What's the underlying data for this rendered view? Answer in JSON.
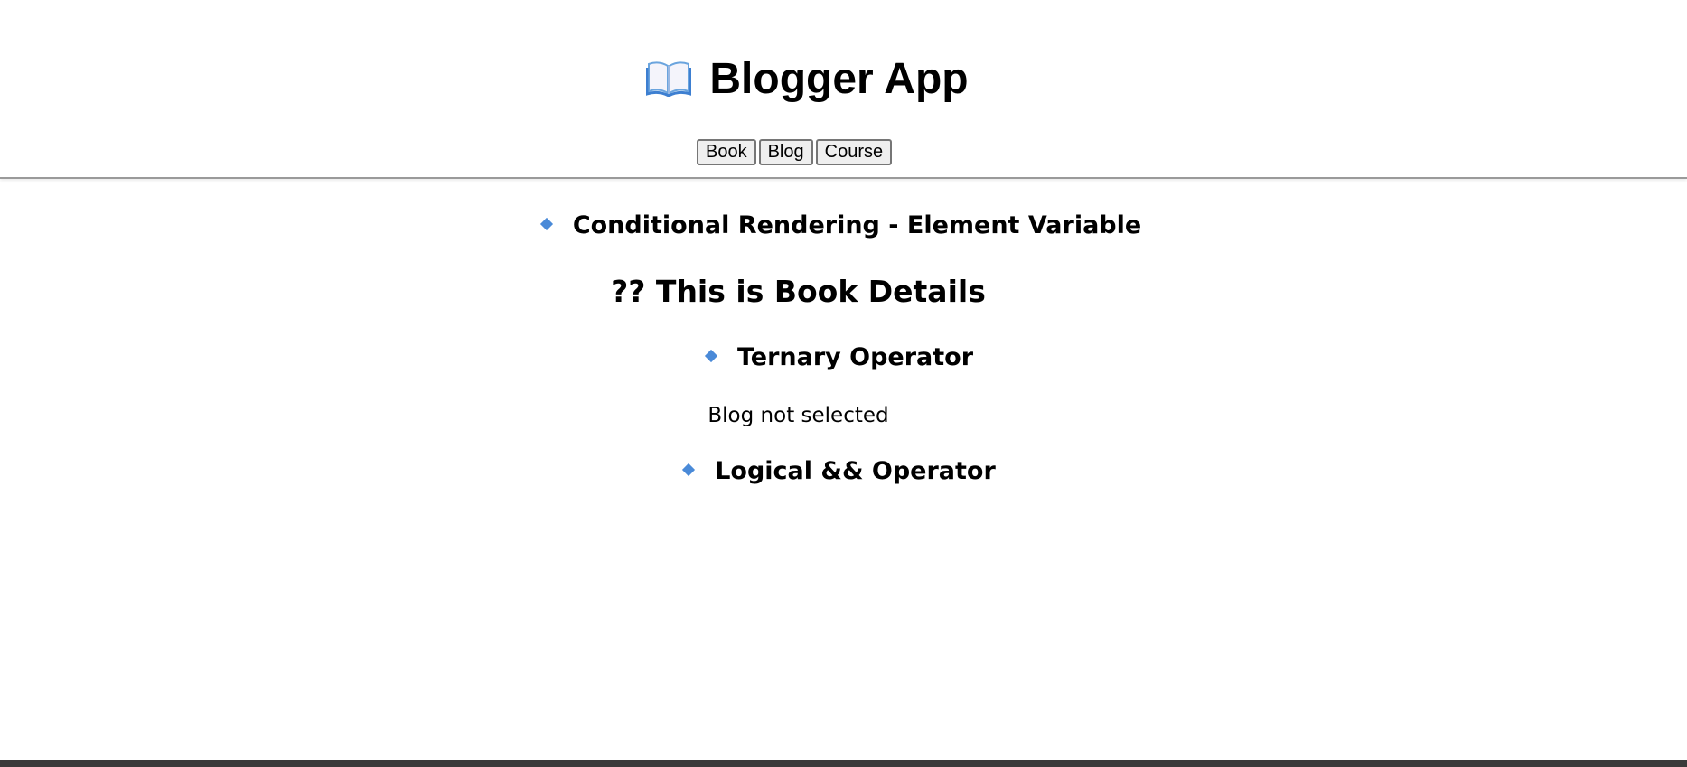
{
  "header": {
    "title": "Blogger App",
    "icon": "open-book-icon",
    "nav": {
      "book_label": "Book",
      "blog_label": "Blog",
      "course_label": "Course"
    }
  },
  "content": {
    "element_variable_heading": "Conditional Rendering - Element Variable",
    "book_details": "?? This is Book Details",
    "ternary_heading": "Ternary Operator",
    "blog_status": "Blog not selected",
    "logical_heading": "Logical && Operator",
    "bullet_color": "#4a8ad8"
  }
}
